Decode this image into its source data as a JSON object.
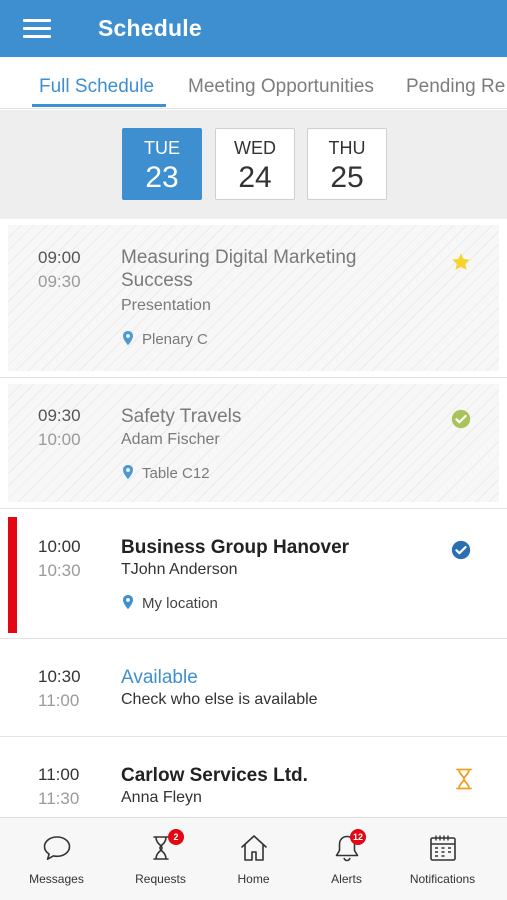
{
  "app": {
    "title": "Schedule"
  },
  "tabs": [
    {
      "label": "Full Schedule",
      "active": true
    },
    {
      "label": "Meeting Opportunities",
      "active": false
    },
    {
      "label": "Pending Re",
      "active": false
    }
  ],
  "days": [
    {
      "dow": "TUE",
      "dom": "23",
      "active": true
    },
    {
      "dow": "WED",
      "dom": "24",
      "active": false
    },
    {
      "dow": "THU",
      "dom": "25",
      "active": false
    }
  ],
  "events": [
    {
      "start": "09:00",
      "end": "09:30",
      "title": "Measuring Digital Marketing Success",
      "subtitle": "Presentation",
      "location": "Plenary C",
      "status_icon": "star-icon",
      "state": "past"
    },
    {
      "start": "09:30",
      "end": "10:00",
      "title": "Safety Travels",
      "subtitle": "Adam Fischer",
      "location": "Table C12",
      "status_icon": "check-circle-icon",
      "state": "past"
    },
    {
      "start": "10:00",
      "end": "10:30",
      "title": "Business Group Hanover",
      "subtitle": "TJohn Anderson",
      "location": "My location",
      "status_icon": "check-circle-icon",
      "state": "current"
    },
    {
      "start": "10:30",
      "end": "11:00",
      "title": "Available",
      "subtitle": "Check who else is available",
      "state": "available"
    },
    {
      "start": "11:00",
      "end": "11:30",
      "title": "Carlow Services Ltd.",
      "subtitle": "Anna Fleyn",
      "status_icon": "hourglass-icon",
      "state": "pending"
    }
  ],
  "bottom_nav": [
    {
      "label": "Messages",
      "icon": "chat-bubble-icon"
    },
    {
      "label": "Requests",
      "icon": "hourglass-icon",
      "badge": "2"
    },
    {
      "label": "Home",
      "icon": "home-icon"
    },
    {
      "label": "Alerts",
      "icon": "bell-icon",
      "badge": "12"
    },
    {
      "label": "Notifications",
      "icon": "calendar-icon"
    }
  ],
  "colors": {
    "primary": "#3d8fd0",
    "current_indicator": "#e30613",
    "star": "#f5d432",
    "check_past": "#a9c35b",
    "check_confirmed": "#2b6fb3",
    "pending": "#f0a020",
    "badge": "#e30613"
  }
}
